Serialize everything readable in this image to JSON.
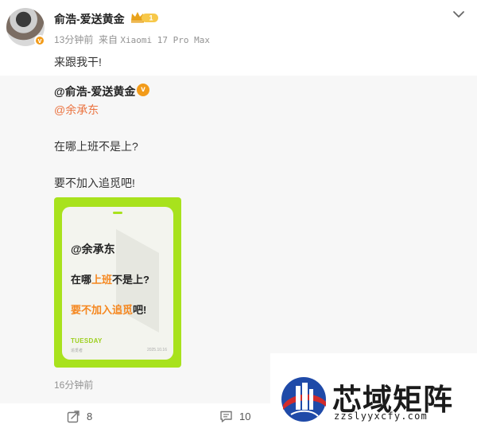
{
  "post": {
    "username": "俞浩-爱送黄金",
    "vip_level": "1",
    "time": "13分钟前",
    "source_prefix": "来自",
    "device": "Xiaomi 17 Pro Max",
    "text": "来跟我干!"
  },
  "repost": {
    "username": "@俞浩-爱送黄金",
    "mention": "@余承东",
    "line1": "在哪上班不是上?",
    "line2": "要不加入追觅吧!",
    "card": {
      "mention": "@余承东",
      "l1_a": "在哪",
      "l1_b": "上班",
      "l1_c": "不是上?",
      "l2_a": "要不加入追觅",
      "l2_b": "吧!",
      "day": "TUESDAY",
      "sub": "追觅者",
      "date": "2025.10.16"
    },
    "time": "16分钟前"
  },
  "actions": {
    "repost_count": "8",
    "comment_count": "10"
  },
  "watermark": {
    "title": "芯域矩阵",
    "url": "zzslyyxcfy.com"
  },
  "colors": {
    "accent_orange": "#eb7340",
    "card_green": "#a8e21d",
    "verified_badge": "#f29b1a"
  }
}
